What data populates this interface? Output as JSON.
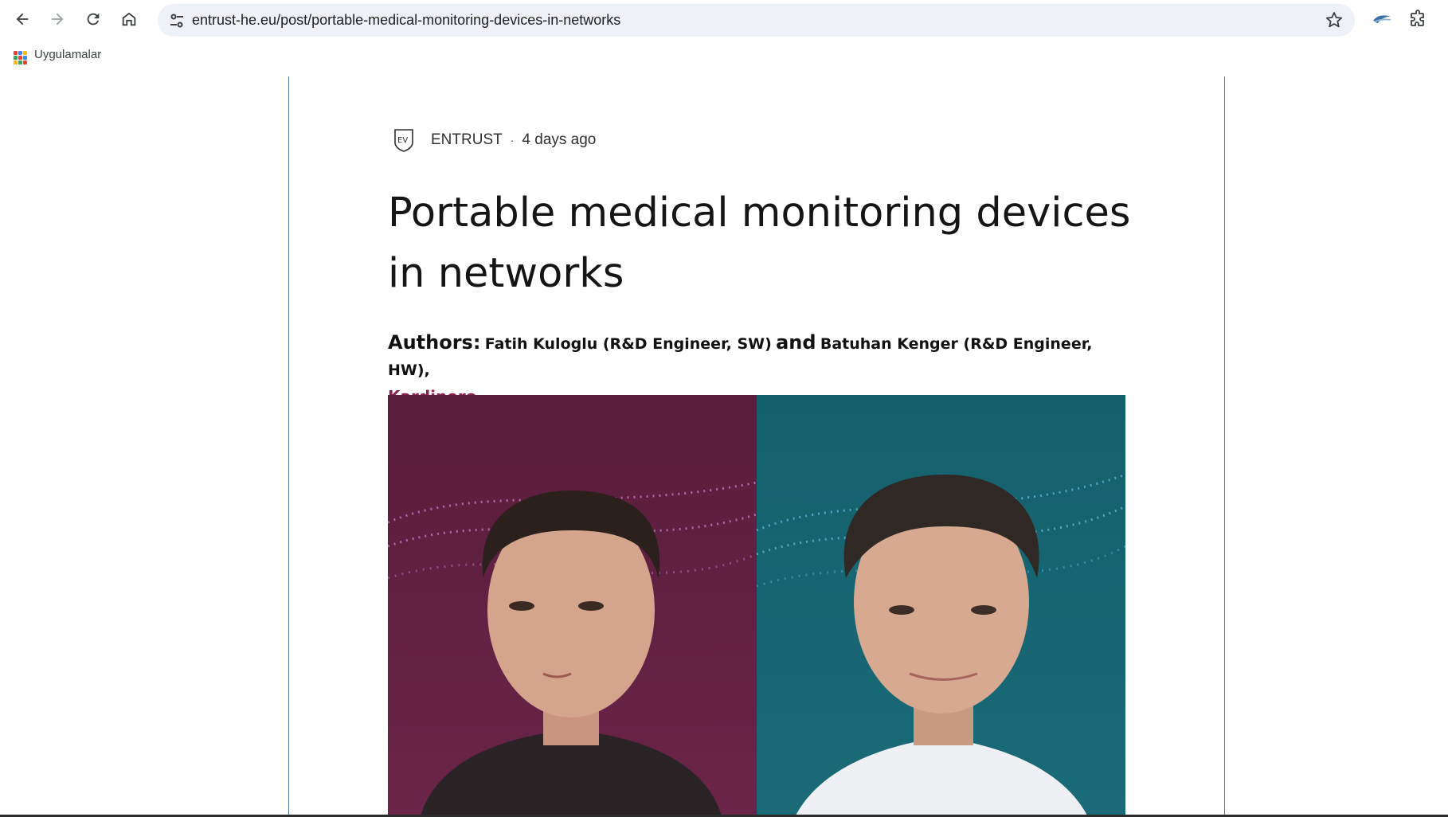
{
  "browser": {
    "url": "entrust-he.eu/post/portable-medical-monitoring-devices-in-networks",
    "bookmarks": [
      {
        "label": "Uygulamalar",
        "icon": "apps-grid-icon"
      }
    ]
  },
  "post": {
    "author": "ENTRUST",
    "separator": "·",
    "date": "4 days ago",
    "title": "Portable medical monitoring devices in networks",
    "authors_label": "Authors:",
    "author_1": "Fatih Kuloglu (R&D Engineer, SW)",
    "and_word": "and",
    "author_2": "Batuhan Kenger (R&D Engineer, HW),",
    "company_link": "Kardinero",
    "hero_colors": {
      "left": "#5a1d3c",
      "right": "#17626f"
    }
  },
  "colors": {
    "link": "#8b2350",
    "article_border": "#4f7fa3"
  }
}
